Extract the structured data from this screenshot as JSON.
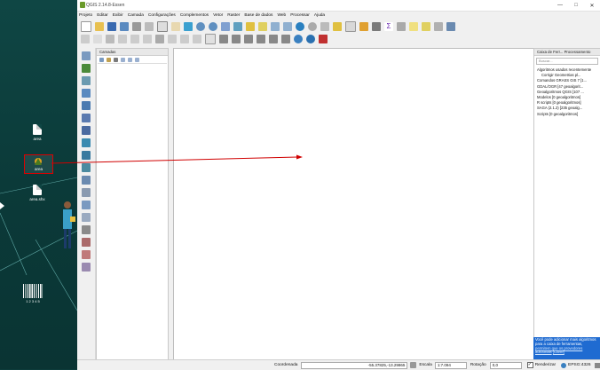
{
  "desktop": {
    "icons": [
      {
        "label": "area"
      },
      {
        "label": "area"
      },
      {
        "label": "area.shx"
      }
    ],
    "barcode_label": "1 2 3 4 5"
  },
  "window": {
    "title": "QGIS 2.14.8-Essen",
    "controls": [
      "—",
      "□",
      "✕"
    ]
  },
  "menu": [
    "Projeto",
    "Editar",
    "Exibir",
    "Camada",
    "Configurações",
    "Complementos",
    "Vetor",
    "Raster",
    "Base de dados",
    "Web",
    "Processar",
    "Ajuda"
  ],
  "layers_panel": {
    "title": "Camadas"
  },
  "toolbox": {
    "title": "Caixa de Ferr... Processamento",
    "search_placeholder": "Buscar...",
    "items": [
      "Algoritmos usados recentemente",
      "Corrigir Geometrias pl...",
      "Comandos GRASS GIS 7 [1...",
      "GDAL/OGR [47 geoalgorit...",
      "Geoalgoritmos QGIS [107 ...",
      "Modelos [0 geoalgoritmos]",
      "R scripts [0 geoalgoritmos]",
      "SAGA (2.1.2) [235 geoalg...",
      "Scripts [0 geoalgoritmos]"
    ]
  },
  "notice": {
    "text": "Você pode adicionar mais algoritmos para a caixa de ferramentas,",
    "link1": "permitem que os provedores adicionais",
    "link2": "[Close]"
  },
  "status": {
    "coord_label": "Coordenada",
    "coord_value": "-55.37825,-13.29865",
    "scale_label": "Escala",
    "scale_value": "1:7.094",
    "rotation_label": "Rotação",
    "rotation_value": "0,0",
    "render_label": "Renderizar",
    "crs": "EPSG:4326"
  },
  "colors": {
    "accent": "#1f6bd1",
    "arrow": "#d00000"
  }
}
